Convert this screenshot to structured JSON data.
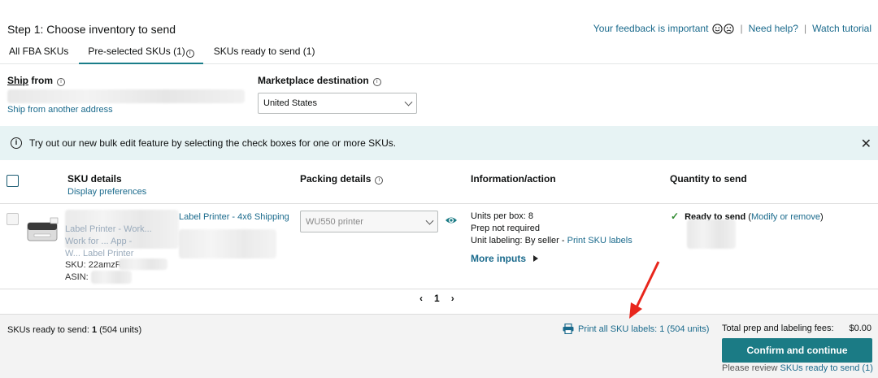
{
  "header": {
    "step_title": "Step 1: Choose inventory to send",
    "feedback": "Your feedback is important",
    "need_help": "Need help?",
    "watch_tutorial": "Watch tutorial",
    "sep": "|"
  },
  "tabs": [
    {
      "label": "All FBA SKUs"
    },
    {
      "label": "Pre-selected SKUs (1)"
    },
    {
      "label": "SKUs ready to send (1)"
    }
  ],
  "ship_from": {
    "label_underlined": "Ship",
    "label_rest": " from",
    "other_link": "Ship from another address"
  },
  "marketplace": {
    "label": "Marketplace destination",
    "selected": "United States"
  },
  "banner": {
    "text": "Try out our new bulk edit feature by selecting the check boxes for one or more SKUs.",
    "icon": "i",
    "close": "✕"
  },
  "table": {
    "headers": {
      "sku_details": "SKU details",
      "packing_details": "Packing details",
      "information": "Information/action",
      "quantity": "Quantity to send"
    },
    "display_prefs": "Display preferences",
    "row": {
      "product_title_line1": "Label Printer - 4x6 Shipping",
      "product_title_line2": "Label Printer - Work...",
      "product_title_line3": "Work for ... App -",
      "product_title_line4": "W... Label Printer",
      "sku": "SKU: 22amzR",
      "asin": "ASIN:",
      "packing_selected": "WU550 printer",
      "units_per_box": "Units per box: 8",
      "prep": "Prep not required",
      "unit_label_text": "Unit labeling: By seller - ",
      "print_sku_labels": "Print SKU labels",
      "more_inputs": "More inputs",
      "ready_to_send": "Ready to send",
      "modify_paren_open": " (",
      "modify": "Modify or remove",
      "modify_paren_close": ")"
    }
  },
  "pager": {
    "prev": "‹",
    "page": "1",
    "next": "›"
  },
  "footer": {
    "ready_label": "SKUs ready to send: ",
    "ready_count": "1",
    "ready_units": " (504 units)",
    "print_all": "Print all SKU labels: 1 (504 units)",
    "fees_label": "Total prep and labeling fees:",
    "fees_value": "$0.00",
    "confirm": "Confirm and continue",
    "review_prefix": "Please review ",
    "review_link": "SKUs ready to send (1)"
  },
  "colors": {
    "accent": "#1b7b85",
    "link": "#1a6a8c",
    "banner_bg": "#e7f3f4",
    "annotation_arrow": "#e8261c"
  }
}
